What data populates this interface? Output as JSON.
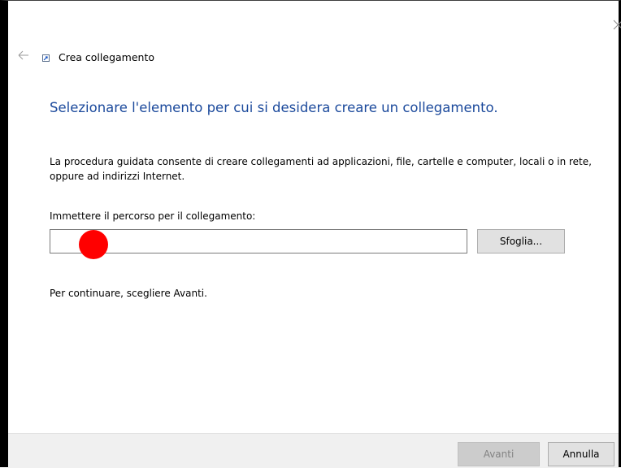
{
  "window": {
    "close_icon": "close-icon",
    "back_icon": "back-arrow-icon"
  },
  "wizard": {
    "title": "Crea collegamento",
    "title_icon": "shortcut-icon"
  },
  "main": {
    "heading": "Selezionare l'elemento per cui si desidera creare un collegamento.",
    "description": "La procedura guidata consente di creare collegamenti ad applicazioni, file, cartelle e computer, locali o in rete, oppure ad indirizzi Internet.",
    "path_label": "Immettere il percorso per il collegamento:",
    "path_value": "",
    "browse_label": "Sfoglia...",
    "continue_text": "Per continuare, scegliere Avanti."
  },
  "footer": {
    "next_label": "Avanti",
    "cancel_label": "Annulla"
  },
  "colors": {
    "heading": "#1c4a9c",
    "footer_bg": "#f0f0f0",
    "button_bg": "#e1e1e1",
    "disabled_button_bg": "#cccccc",
    "disabled_text": "#838383",
    "marker": "#ff0000"
  }
}
